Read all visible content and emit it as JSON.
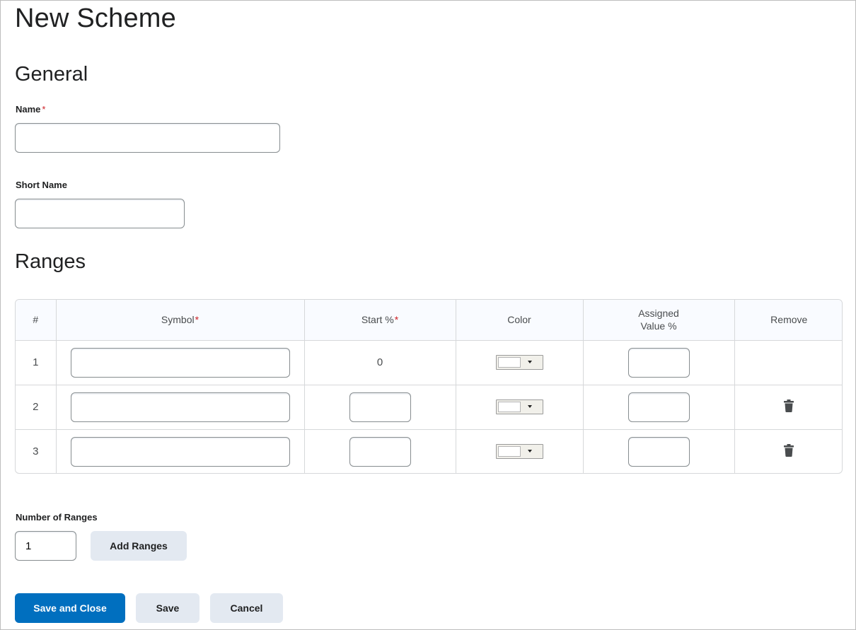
{
  "page": {
    "title": "New Scheme"
  },
  "general": {
    "heading": "General",
    "name_label": "Name",
    "name_required": "*",
    "name_value": "",
    "short_name_label": "Short Name",
    "short_name_value": ""
  },
  "ranges": {
    "heading": "Ranges",
    "columns": {
      "index": "#",
      "symbol": "Symbol",
      "symbol_required": "*",
      "start": "Start %",
      "start_required": "*",
      "color": "Color",
      "assigned_line1": "Assigned",
      "assigned_line2": "Value %",
      "remove": "Remove"
    },
    "rows": [
      {
        "index": "1",
        "symbol": "",
        "start": "0",
        "start_editable": false,
        "color": "#ffffff",
        "assigned": "",
        "removable": false
      },
      {
        "index": "2",
        "symbol": "",
        "start": "",
        "start_editable": true,
        "color": "#ffffff",
        "assigned": "",
        "removable": true,
        "remove_icon": "trash-icon"
      },
      {
        "index": "3",
        "symbol": "",
        "start": "",
        "start_editable": true,
        "color": "#ffffff",
        "assigned": "",
        "removable": true,
        "remove_icon": "trash-icon"
      }
    ]
  },
  "number_of_ranges": {
    "label": "Number of Ranges",
    "value": "1",
    "add_button": "Add Ranges"
  },
  "footer": {
    "save_close": "Save and Close",
    "save": "Save",
    "cancel": "Cancel"
  },
  "colors": {
    "primary": "#006fbf",
    "secondary_button": "#e3e9f1",
    "required": "#cd2026"
  }
}
